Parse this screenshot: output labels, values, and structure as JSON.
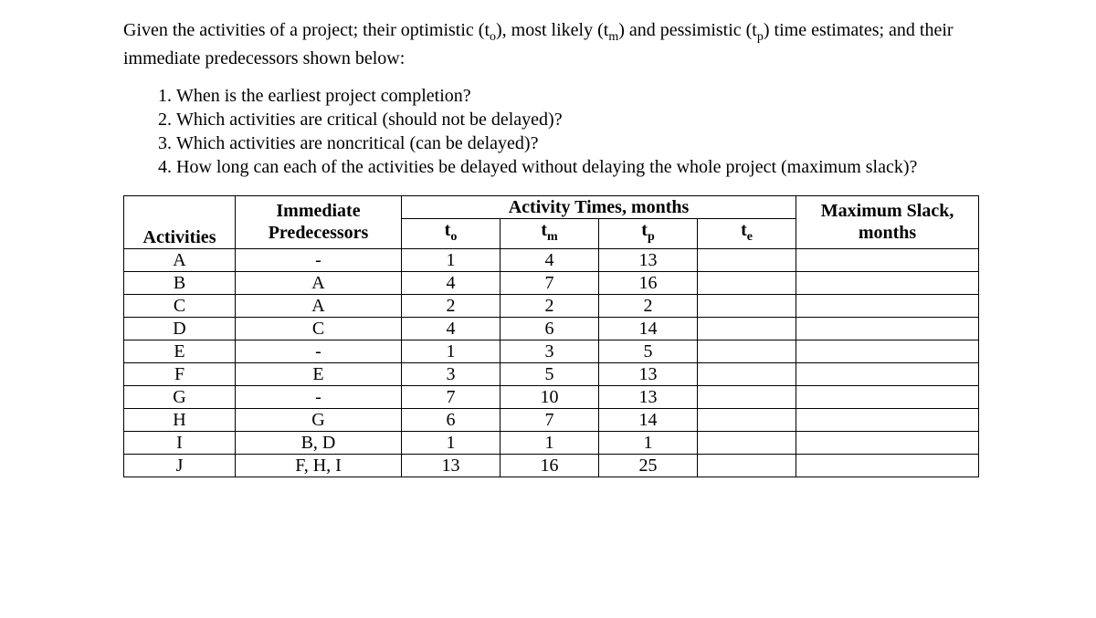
{
  "intro_parts": {
    "p1": "Given the activities of a project; their optimistic (t",
    "p2": "), most likely (t",
    "p3": ") and pessimistic (t",
    "p4": ") time estimates; and their immediate predecessors shown below:",
    "s1": "o",
    "s2": "m",
    "s3": "p"
  },
  "questions": [
    "When is the earliest project completion?",
    "Which activities are critical (should not be delayed)?",
    "Which activities are noncritical (can be delayed)?",
    "How long can each of the activities be delayed without delaying the whole project (maximum slack)?"
  ],
  "headers": {
    "activities": "Activities",
    "predecessors_l1": "Immediate",
    "predecessors_l2": "Predecessors",
    "activity_times": "Activity Times, months",
    "to": "o",
    "tm": "m",
    "tp": "p",
    "te": "e",
    "slack_l1": "Maximum Slack,",
    "slack_l2": "months",
    "t_prefix": "t"
  },
  "rows": [
    {
      "act": "A",
      "pred": "-",
      "to": "1",
      "tm": "4",
      "tp": "13",
      "te": "",
      "slack": ""
    },
    {
      "act": "B",
      "pred": "A",
      "to": "4",
      "tm": "7",
      "tp": "16",
      "te": "",
      "slack": ""
    },
    {
      "act": "C",
      "pred": "A",
      "to": "2",
      "tm": "2",
      "tp": "2",
      "te": "",
      "slack": ""
    },
    {
      "act": "D",
      "pred": "C",
      "to": "4",
      "tm": "6",
      "tp": "14",
      "te": "",
      "slack": ""
    },
    {
      "act": "E",
      "pred": "-",
      "to": "1",
      "tm": "3",
      "tp": "5",
      "te": "",
      "slack": ""
    },
    {
      "act": "F",
      "pred": "E",
      "to": "3",
      "tm": "5",
      "tp": "13",
      "te": "",
      "slack": ""
    },
    {
      "act": "G",
      "pred": "-",
      "to": "7",
      "tm": "10",
      "tp": "13",
      "te": "",
      "slack": ""
    },
    {
      "act": "H",
      "pred": "G",
      "to": "6",
      "tm": "7",
      "tp": "14",
      "te": "",
      "slack": ""
    },
    {
      "act": "I",
      "pred": "B, D",
      "to": "1",
      "tm": "1",
      "tp": "1",
      "te": "",
      "slack": ""
    },
    {
      "act": "J",
      "pred": "F, H, I",
      "to": "13",
      "tm": "16",
      "tp": "25",
      "te": "",
      "slack": ""
    }
  ],
  "chart_data": {
    "type": "table",
    "title": "PERT Activity Time Estimates",
    "columns": [
      "Activities",
      "Immediate Predecessors",
      "t_o",
      "t_m",
      "t_p",
      "t_e",
      "Maximum Slack, months"
    ],
    "rows": [
      [
        "A",
        "-",
        1,
        4,
        13,
        null,
        null
      ],
      [
        "B",
        "A",
        4,
        7,
        16,
        null,
        null
      ],
      [
        "C",
        "A",
        2,
        2,
        2,
        null,
        null
      ],
      [
        "D",
        "C",
        4,
        6,
        14,
        null,
        null
      ],
      [
        "E",
        "-",
        1,
        3,
        5,
        null,
        null
      ],
      [
        "F",
        "E",
        3,
        5,
        13,
        null,
        null
      ],
      [
        "G",
        "-",
        7,
        10,
        13,
        null,
        null
      ],
      [
        "H",
        "G",
        6,
        7,
        14,
        null,
        null
      ],
      [
        "I",
        "B, D",
        1,
        1,
        1,
        null,
        null
      ],
      [
        "J",
        "F, H, I",
        13,
        16,
        25,
        null,
        null
      ]
    ]
  }
}
